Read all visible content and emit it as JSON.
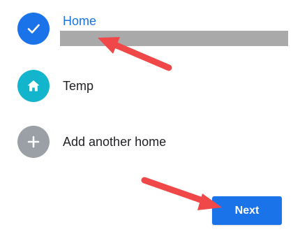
{
  "homes": [
    {
      "label": "Home",
      "icon": "check-icon",
      "selected": true,
      "label_color": "#1a73e8",
      "avatar_color": "#1a73e8"
    },
    {
      "label": "Temp",
      "icon": "house-icon",
      "selected": false,
      "label_color": "#202124",
      "avatar_color": "#12b5cb"
    },
    {
      "label": "Add another home",
      "icon": "plus-icon",
      "selected": false,
      "label_color": "#202124",
      "avatar_color": "#9aa0a6"
    }
  ],
  "actions": {
    "next_label": "Next",
    "next_color": "#1a73e8"
  },
  "annotations": {
    "arrow_color": "#f04848",
    "redaction_color": "#a9a9a9"
  }
}
